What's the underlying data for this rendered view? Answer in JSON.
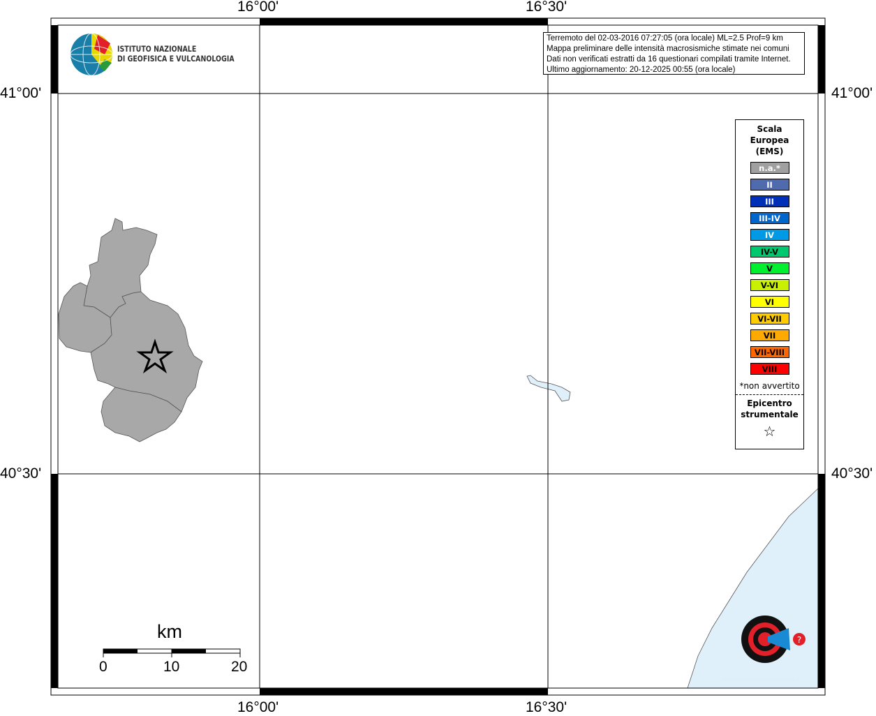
{
  "axes": {
    "lon_ticks": [
      "16°00'",
      "16°30'"
    ],
    "lat_ticks": [
      "41°00'",
      "40°30'"
    ]
  },
  "logo_inst": {
    "line1": "ISTITUTO NAZIONALE",
    "line2": "DI GEOFISICA E VULCANOLOGIA"
  },
  "info": {
    "line1": "Terremoto del 02-03-2016 07:27:05 (ora locale) ML=2.5 Prof=9 km",
    "line2": "Mappa preliminare delle intensità macrosismiche stimate nei comuni",
    "line3": "Dati non verificati estratti da 16 questionari compilati tramite Internet.",
    "line4": "Ultimo aggiornamento: 20-12-2025 00:55 (ora locale)"
  },
  "legend": {
    "title_lines": [
      "Scala",
      "Europea",
      "(EMS)"
    ],
    "items": [
      {
        "label": "n.a.*",
        "color": "#a0a0a0",
        "text": "#ffffff"
      },
      {
        "label": "II",
        "color": "#4f6aad",
        "text": "#ffffff"
      },
      {
        "label": "III",
        "color": "#0030b8",
        "text": "#ffffff"
      },
      {
        "label": "III-IV",
        "color": "#0066cc",
        "text": "#ffffff"
      },
      {
        "label": "IV",
        "color": "#0099e6",
        "text": "#ffffff"
      },
      {
        "label": "IV-V",
        "color": "#00c86e",
        "text": "#000000"
      },
      {
        "label": "V",
        "color": "#00f030",
        "text": "#000000"
      },
      {
        "label": "V-VI",
        "color": "#c8f000",
        "text": "#000000"
      },
      {
        "label": "VI",
        "color": "#ffff00",
        "text": "#000000"
      },
      {
        "label": "VI-VII",
        "color": "#ffcc00",
        "text": "#000000"
      },
      {
        "label": "VII",
        "color": "#ffaa00",
        "text": "#000000"
      },
      {
        "label": "VII-VIII",
        "color": "#ff6600",
        "text": "#000000"
      },
      {
        "label": "VIII",
        "color": "#ff0000",
        "text": "#000000"
      }
    ],
    "note": "*non avvertito",
    "epicenter_lines": [
      "Epicentro",
      "strumentale"
    ],
    "star": "☆"
  },
  "scalebar": {
    "unit": "km",
    "labels": [
      "0",
      "10",
      "20"
    ]
  },
  "watermark": {
    "text": "www.haisentitoilterremoto.it"
  }
}
